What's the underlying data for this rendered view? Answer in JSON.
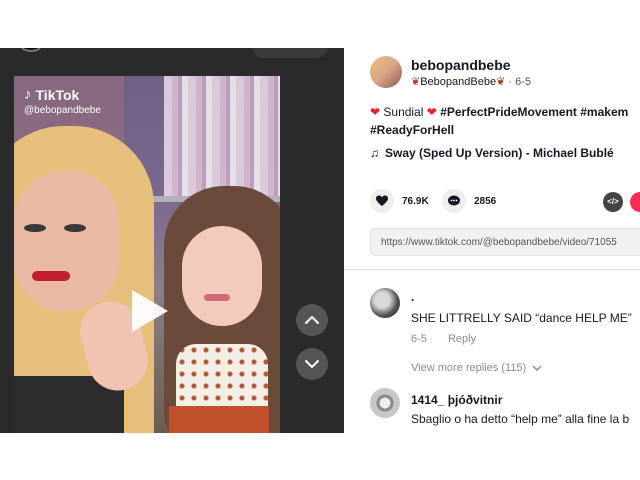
{
  "viewer": {
    "brand": "TikTok",
    "handle": "@bebopandbebe"
  },
  "author": {
    "username": "bebopandbebe",
    "display_name": "BebopandBebe",
    "date": "6-5"
  },
  "caption": {
    "sundial": "Sundial",
    "tag1": "#PerfectPrideMovement",
    "tag2": "#makem",
    "tag3": "#ReadyForHell"
  },
  "music": "Sway (Sped Up Version) - Michael Bublé",
  "stats": {
    "likes": "76.9K",
    "comments": "2856"
  },
  "share": {
    "link": "https://www.tiktok.com/@bebopandbebe/video/71055"
  },
  "comments": [
    {
      "name": ".",
      "text": "SHE LITTRELLY SAID “dance HELP ME”",
      "date": "6-5",
      "reply_label": "Reply",
      "view_replies": "View more replies (115)"
    },
    {
      "name": "1414_ þjóðvitnir",
      "text": "Sbaglio o ha detto “help me” alla fine la b"
    }
  ],
  "colors": {
    "accent": "#fe2c55",
    "text": "#161823",
    "muted": "#8a8b91",
    "heart": "#e8202a"
  }
}
